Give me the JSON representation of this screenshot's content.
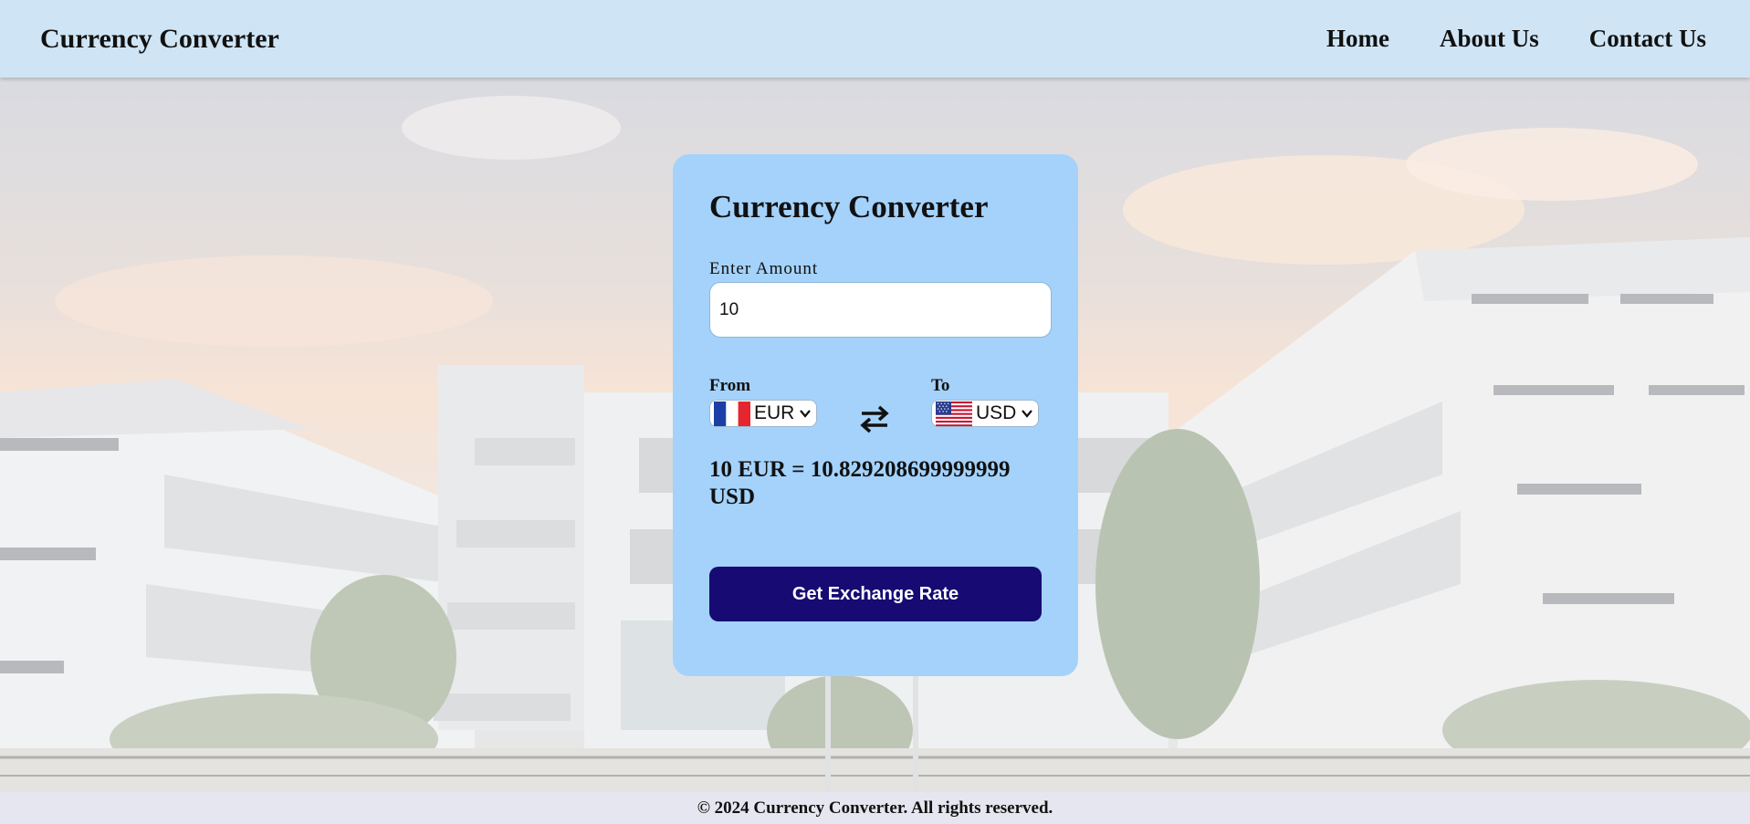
{
  "navbar": {
    "brand": "Currency Converter",
    "links": [
      "Home",
      "About Us",
      "Contact Us"
    ]
  },
  "card": {
    "title": "Currency Converter",
    "amount_label": "Enter Amount",
    "amount_value": "10",
    "from_label": "From",
    "from_currency": "EUR",
    "to_label": "To",
    "to_currency": "USD",
    "result": "10 EUR = 10.829208699999999 USD",
    "button_label": "Get Exchange Rate"
  },
  "footer": {
    "text": "© 2024 Currency Converter. All rights reserved."
  },
  "icons": {
    "from_flag": "france-flag-icon",
    "to_flag": "us-flag-icon",
    "swap": "swap-arrows-icon",
    "dropdown": "chevron-down-icon"
  },
  "colors": {
    "navbar_bg": "#cfe5f5",
    "card_bg": "#a4d2fb",
    "button_bg": "#170a73",
    "footer_bg": "#e6e6f0"
  }
}
